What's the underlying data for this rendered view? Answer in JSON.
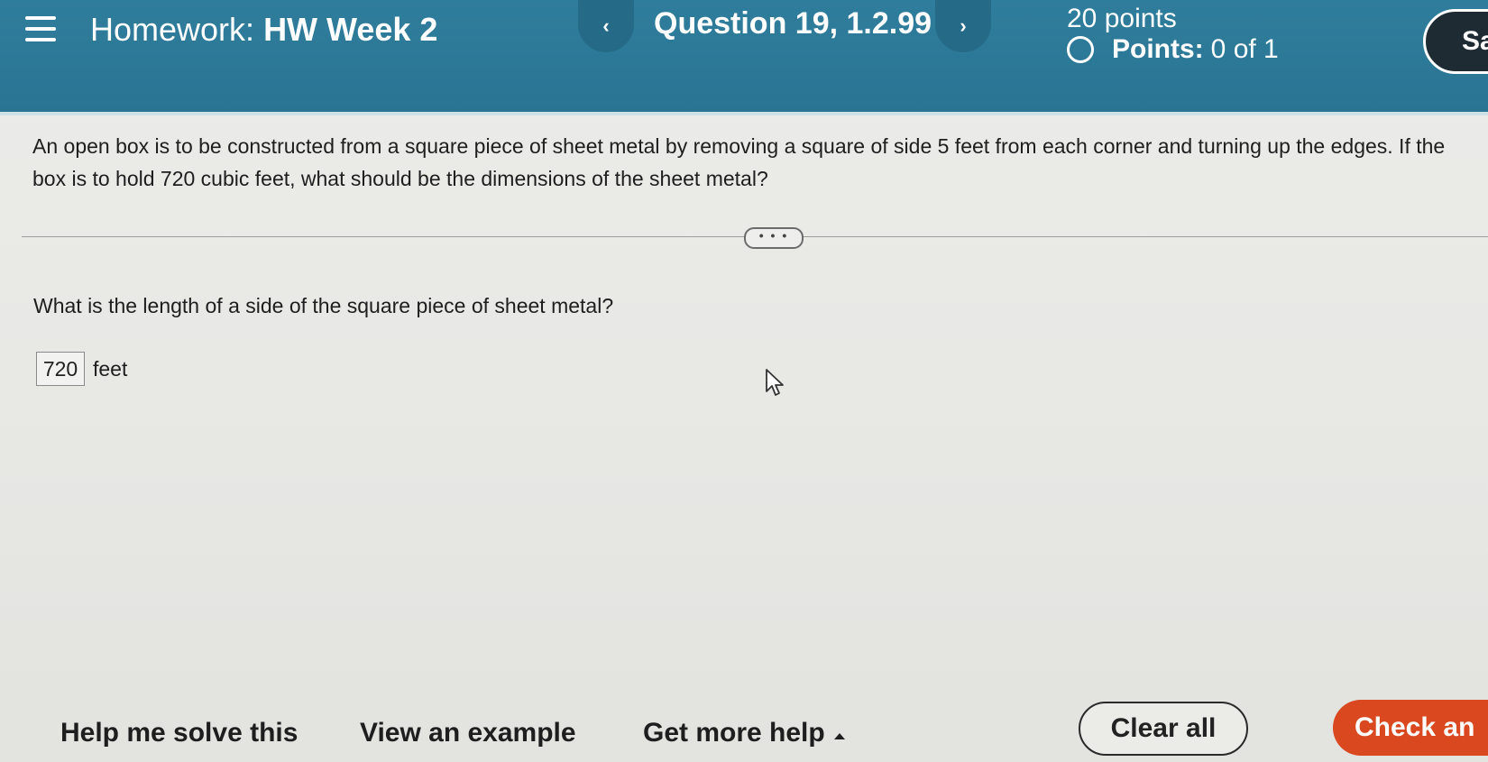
{
  "header": {
    "homework_label": "Homework:",
    "homework_name": "HW Week 2",
    "question_title": "Question 19, 1.2.99",
    "prev_icon": "chevron-left-icon",
    "prev_glyph": "‹",
    "next_icon": "chevron-right-icon",
    "next_glyph": "›",
    "points_total": "20 points",
    "points_label": "Points:",
    "points_value": "0 of 1",
    "save_label": "Sa"
  },
  "problem": {
    "text": "An open box is to be constructed from a square piece of sheet metal by removing a square of side 5 feet from each corner and turning up the edges. If the box is to hold 720 cubic feet, what should be the dimensions of the sheet metal?",
    "expand_label": "• • •",
    "sub_question": "What is the length of a side of the square piece of sheet metal?",
    "answer_value": "720",
    "answer_unit": "feet"
  },
  "footer": {
    "help_solve": "Help me solve this",
    "view_example": "View an example",
    "more_help": "Get more help",
    "clear_all": "Clear all",
    "check_answer": "Check an"
  },
  "colors": {
    "header_bg": "#2f7d9c",
    "check_button": "#d9481f",
    "save_button": "#1f2b33"
  }
}
